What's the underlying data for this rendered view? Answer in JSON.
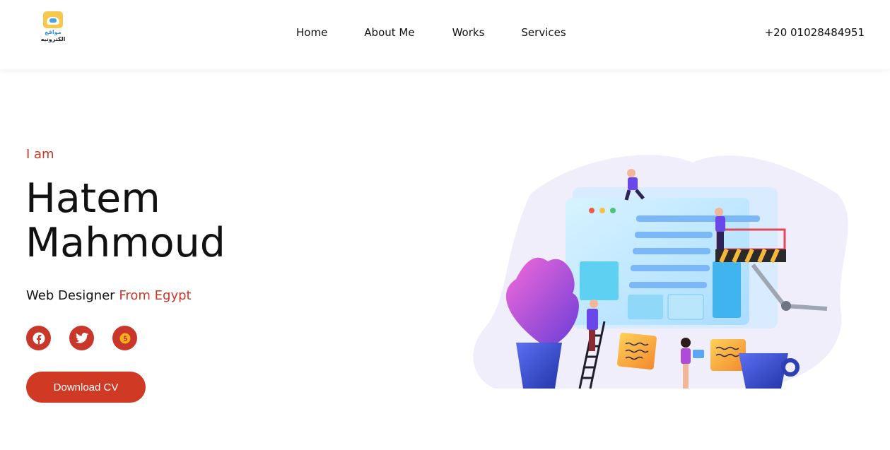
{
  "header": {
    "logo_line1": "مواقع",
    "logo_line2": "الكترونيه",
    "nav": [
      "Home",
      "About Me",
      "Works",
      "Services"
    ],
    "phone": "+20 01028484951"
  },
  "hero": {
    "intro": "I am",
    "name_line1": "Hatem",
    "name_line2": "Mahmoud",
    "role": "Web Designer",
    "role_accent": "From Egypt",
    "social": [
      "facebook-icon",
      "twitter-icon",
      "blogger-icon"
    ],
    "cta_label": "Download CV"
  },
  "colors": {
    "accent": "#c9362a",
    "button": "#d03a24",
    "text": "#111111"
  }
}
